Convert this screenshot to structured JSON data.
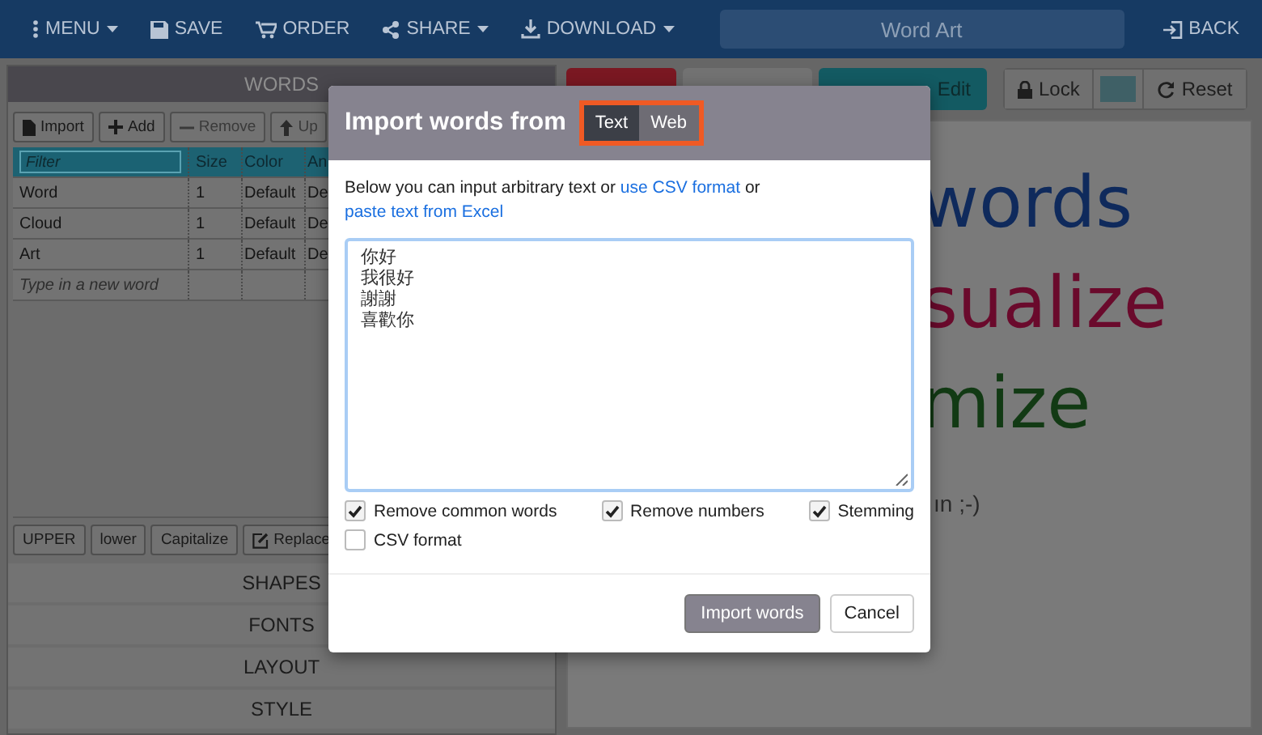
{
  "topbar": {
    "items": [
      {
        "label": "MENU",
        "dropdown": true
      },
      {
        "label": "SAVE",
        "dropdown": false
      },
      {
        "label": "ORDER",
        "dropdown": false
      },
      {
        "label": "SHARE",
        "dropdown": true
      },
      {
        "label": "DOWNLOAD",
        "dropdown": true
      }
    ],
    "title": "Word Art",
    "back": "BACK"
  },
  "words_panel": {
    "title": "WORDS",
    "buttons": [
      {
        "label": "Import",
        "enabled": true
      },
      {
        "label": "Add",
        "enabled": true
      },
      {
        "label": "Remove",
        "enabled": false
      },
      {
        "label": "Up",
        "enabled": false
      }
    ],
    "table": {
      "columns": [
        {
          "kind": "filter",
          "placeholder": "Filter"
        },
        {
          "kind": "header",
          "label": "Size"
        },
        {
          "kind": "header",
          "label": "Color"
        },
        {
          "kind": "header",
          "label": "An"
        }
      ],
      "rows": [
        [
          "Word",
          "1",
          "Default",
          "De"
        ],
        [
          "Cloud",
          "1",
          "Default",
          "De"
        ],
        [
          "Art",
          "1",
          "Default",
          "De"
        ]
      ],
      "new_word_placeholder": "Type in a new word"
    },
    "case_buttons": [
      "UPPER",
      "lower",
      "Capitalize",
      "Replace"
    ],
    "sections": [
      "SHAPES",
      "FONTS",
      "LAYOUT",
      "STYLE"
    ]
  },
  "canvas_toolbar": {
    "edit": "Edit",
    "lock": "Lock",
    "reset": "Reset"
  },
  "canvas_words": [
    {
      "text": "words",
      "color": "#0f2a5c"
    },
    {
      "text": "sualize",
      "color": "#6a0a2c"
    },
    {
      "text": "mize",
      "color": "#123a14"
    }
  ],
  "canvas_note": "ın ;-)",
  "modal": {
    "title": "Import words from",
    "sources": [
      {
        "label": "Text",
        "selected": true
      },
      {
        "label": "Web",
        "selected": false
      }
    ],
    "intro": "Below you can input arbitrary text or",
    "intro_mid": "or",
    "link_csv": "use CSV format",
    "link_excel": "paste text from Excel",
    "text_lines": [
      "你好",
      "我很好",
      "謝謝",
      "喜歡你"
    ],
    "options": [
      {
        "label": "Remove common words",
        "checked": true
      },
      {
        "label": "Remove numbers",
        "checked": true
      },
      {
        "label": "Stemming",
        "checked": true
      },
      {
        "label": "CSV format",
        "checked": false
      }
    ],
    "import_button": "Import words",
    "cancel_button": "Cancel"
  }
}
